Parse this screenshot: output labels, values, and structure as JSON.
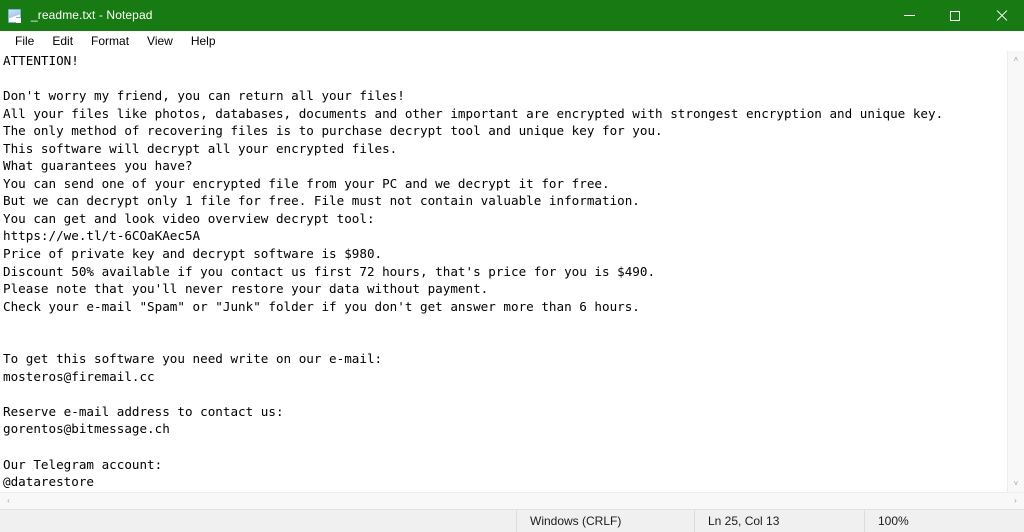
{
  "window": {
    "title": "_readme.txt - Notepad",
    "icon": "notepad-icon",
    "titlebar_color": "#177a12",
    "controls": {
      "minimize": "Minimize",
      "maximize": "Maximize",
      "close": "Close"
    }
  },
  "menubar": {
    "items": [
      {
        "label": "File"
      },
      {
        "label": "Edit"
      },
      {
        "label": "Format"
      },
      {
        "label": "View"
      },
      {
        "label": "Help"
      }
    ]
  },
  "document": {
    "filename": "_readme.txt",
    "lines": [
      "ATTENTION!",
      "",
      "Don't worry my friend, you can return all your files!",
      "All your files like photos, databases, documents and other important are encrypted with strongest encryption and unique key.",
      "The only method of recovering files is to purchase decrypt tool and unique key for you.",
      "This software will decrypt all your encrypted files.",
      "What guarantees you have?",
      "You can send one of your encrypted file from your PC and we decrypt it for free.",
      "But we can decrypt only 1 file for free. File must not contain valuable information.",
      "You can get and look video overview decrypt tool:",
      "https://we.tl/t-6COaKAec5A",
      "Price of private key and decrypt software is $980.",
      "Discount 50% available if you contact us first 72 hours, that's price for you is $490.",
      "Please note that you'll never restore your data without payment.",
      "Check your e-mail \"Spam\" or \"Junk\" folder if you don't get answer more than 6 hours.",
      "",
      "",
      "To get this software you need write on our e-mail:",
      "mosteros@firemail.cc",
      "",
      "Reserve e-mail address to contact us:",
      "gorentos@bitmessage.ch",
      "",
      "Our Telegram account:",
      "@datarestore"
    ]
  },
  "scrollbars": {
    "vertical": {
      "up_arrow": "˄",
      "down_arrow": "˅"
    },
    "horizontal": {
      "left_arrow": "‹",
      "right_arrow": "›"
    }
  },
  "statusbar": {
    "line_ending": "Windows (CRLF)",
    "cursor_position": "Ln 25, Col 13",
    "zoom": "100%"
  }
}
